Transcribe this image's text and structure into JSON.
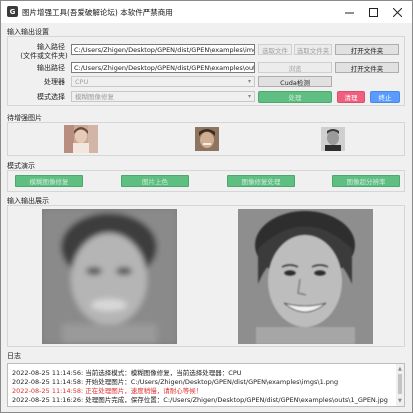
{
  "window": {
    "title": "图片增强工具(吾爱破解论坛) 本软件严禁商用",
    "icon": "app-icon"
  },
  "io_settings": {
    "group_label": "输入输出设置",
    "input_label": "输入路径",
    "input_sublabel": "(文件或文件夹)",
    "input_value": "C:/Users/Zhigen/Desktop/GPEN/dist/GPEN\\examples\\imgs",
    "select_file_label": "选取文件",
    "select_folder_label": "选取文件夹",
    "open_folder_label": "打开文件夹",
    "output_label": "输出路径",
    "output_value": "C:/Users/Zhigen/Desktop/GPEN/dist/GPEN\\examples\\outs",
    "browse_label": "浏览",
    "open_folder2_label": "打开文件夹",
    "processor_label": "处理器",
    "processor_value": "CPU",
    "cuda_label": "Cuda检测",
    "mode_label": "模式选择",
    "mode_value": "模糊图像修复",
    "process_label": "处理",
    "clear_label": "清理",
    "stop_label": "终止",
    "colors": {
      "process": "#5fbf83",
      "clear": "#f0607e",
      "stop": "#5a9bff"
    }
  },
  "pending": {
    "group_label": "待增强图片"
  },
  "mode_demo": {
    "group_label": "模式演示",
    "buttons": [
      "模糊图像修复",
      "图片上色",
      "图像修复处理",
      "图像超分辨率"
    ]
  },
  "io_display": {
    "group_label": "输入输出展示"
  },
  "log": {
    "group_label": "日志",
    "lines": [
      {
        "text": "2022-08-25 11:14:56: 当前选择模式：模糊图像修复，当前选择处理器：CPU",
        "color": "#222222"
      },
      {
        "text": "2022-08-25 11:14:58: 开始处理图片：C:/Users/Zhigen/Desktop/GPEN/dist/GPEN\\examples\\imgs\\1.png",
        "color": "#222222"
      },
      {
        "text": "2022-08-25 11:14:58: 正在处理图片，速度稍慢，请耐心等候！",
        "color": "#e03030"
      },
      {
        "text": "2022-08-25 11:16:26: 处理图片完成，保存位置：C:/Users/Zhigen/Desktop/GPEN/dist/GPEN\\examples\\outs\\1_GPEN.jpg",
        "color": "#222222"
      }
    ]
  }
}
